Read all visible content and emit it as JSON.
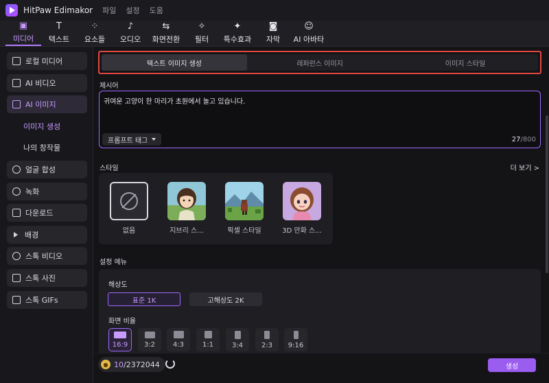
{
  "titlebar": {
    "app_name": "HitPaw Edimakor",
    "menu": [
      "파일",
      "설정",
      "도움"
    ]
  },
  "toolbar": {
    "tools": [
      {
        "label": "미디어",
        "icon": "media-icon",
        "active": true
      },
      {
        "label": "텍스트",
        "icon": "text-icon"
      },
      {
        "label": "요소들",
        "icon": "elements-icon"
      },
      {
        "label": "오디오",
        "icon": "audio-icon"
      },
      {
        "label": "화면전환",
        "icon": "transition-icon"
      },
      {
        "label": "필터",
        "icon": "filter-icon"
      },
      {
        "label": "특수효과",
        "icon": "effects-icon"
      },
      {
        "label": "자막",
        "icon": "subtitle-icon"
      },
      {
        "label": "AI 아바타",
        "icon": "ai-avatar-icon"
      }
    ]
  },
  "sidebar": {
    "items": [
      {
        "label": "로컬 미디어",
        "icon": "folder-icon"
      },
      {
        "label": "AI 비디오",
        "icon": "ai-video-icon"
      },
      {
        "label": "AI 이미지",
        "icon": "ai-image-icon",
        "active": true
      },
      {
        "label": "이미지 생성",
        "sub": true,
        "active": true
      },
      {
        "label": "나의 창작물",
        "sub": true
      },
      {
        "label": "얼굴 합성",
        "icon": "face-swap-icon"
      },
      {
        "label": "녹화",
        "icon": "record-icon"
      },
      {
        "label": "다운로드",
        "icon": "download-icon"
      },
      {
        "label": "배경",
        "icon": "background-icon"
      },
      {
        "label": "스톡 비디오",
        "icon": "stock-video-icon"
      },
      {
        "label": "스톡 사진",
        "icon": "stock-photo-icon"
      },
      {
        "label": "스톡 GIFs",
        "icon": "gif-icon"
      }
    ]
  },
  "tabs": [
    {
      "label": "텍스트 이미지 생성",
      "active": true
    },
    {
      "label": "레퍼런스 이미지"
    },
    {
      "label": "이미지 스타일"
    }
  ],
  "prompt": {
    "title": "제시어",
    "value": "귀여운 고양이 한 마리가 초원에서 놀고 있습니다.",
    "tag_button": "프롬프트 태그",
    "count": "27",
    "max": "/800"
  },
  "styles": {
    "title": "스타일",
    "more": "더 보기 >",
    "items": [
      {
        "label": "없음",
        "icon": "none-icon"
      },
      {
        "label": "지브리 스..."
      },
      {
        "label": "픽셀 스타일"
      },
      {
        "label": "3D 만화 스..."
      }
    ]
  },
  "settings": {
    "title": "설정 메뉴",
    "resolution_label": "해상도",
    "resolutions": [
      "표준 1K",
      "고해상도 2K"
    ],
    "ratio_label": "화면 비율",
    "ratios": [
      "16:9",
      "3:2",
      "4:3",
      "1:1",
      "3:4",
      "2:3",
      "9:16"
    ]
  },
  "footer": {
    "credits_used": "10",
    "credits_total": "/2372044",
    "generate": "생성"
  },
  "colors": {
    "accent": "#b47cff",
    "highlight_border": "#e2473f",
    "generate_button": "#9b5cf0"
  }
}
